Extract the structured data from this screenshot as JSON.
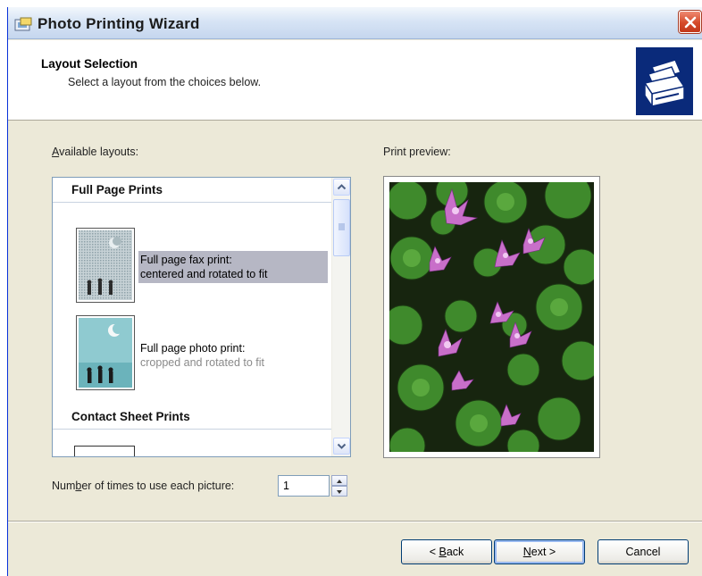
{
  "window": {
    "title": "Photo Printing Wizard"
  },
  "header": {
    "title": "Layout Selection",
    "subtitle": "Select a layout from the choices below."
  },
  "layouts": {
    "label_prefix": "",
    "label_accel": "A",
    "label_rest": "vailable layouts:",
    "groups": [
      {
        "name": "Full Page Prints",
        "items": [
          {
            "line1": "Full page fax print:",
            "line2": "centered and rotated to fit",
            "selected": true
          },
          {
            "line1": "Full page photo print:",
            "line2": "cropped and rotated to fit",
            "selected": false
          }
        ]
      },
      {
        "name": "Contact Sheet Prints",
        "items": []
      }
    ]
  },
  "preview": {
    "label": "Print preview:"
  },
  "copies": {
    "label_prefix": "Num",
    "label_accel": "b",
    "label_rest": "er of times to use each picture:",
    "value": "1"
  },
  "buttons": {
    "back_pre": "< ",
    "back_accel": "B",
    "back_rest": "ack",
    "next_pre": "",
    "next_accel": "N",
    "next_rest": "ext >",
    "cancel": "Cancel"
  },
  "colors": {
    "selection": "#b6b7c4",
    "face": "#ece9d8",
    "header_graphic": "#0a2a7a"
  }
}
